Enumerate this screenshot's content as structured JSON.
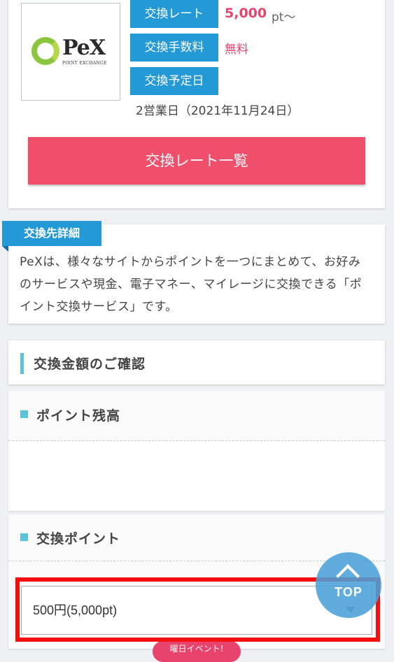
{
  "exchange_card": {
    "logo_text": "PeX",
    "logo_subtext": "POINT EXCHANGE",
    "rate_label": "交換レート",
    "rate_value": "5,000",
    "rate_unit": "pt〜",
    "fee_label": "交換手数料",
    "fee_value": "無料",
    "date_label": "交換予定日",
    "date_value": "2営業日（2021年11月24日）",
    "rate_list_button": "交換レート一覧"
  },
  "detail": {
    "ribbon": "交換先詳細",
    "text": "PeXは、様々なサイトからポイントを一つにまとめて、お好みのサービスや現金、電子マネー、マイレージに交換できる「ポイント交換サービス」です。"
  },
  "confirm": {
    "title": "交換金額のご確認",
    "balance_title": "ポイント残高",
    "exchange_title": "交換ポイント",
    "selected_amount": "500円(5,000pt)",
    "event_badge": "曜日イベント!"
  },
  "top_button": {
    "label": "TOP"
  },
  "colors": {
    "accent_blue": "#2399d6",
    "accent_pink": "#e8436d",
    "button_red": "#f04f6b",
    "highlight_red": "#f20f10"
  }
}
